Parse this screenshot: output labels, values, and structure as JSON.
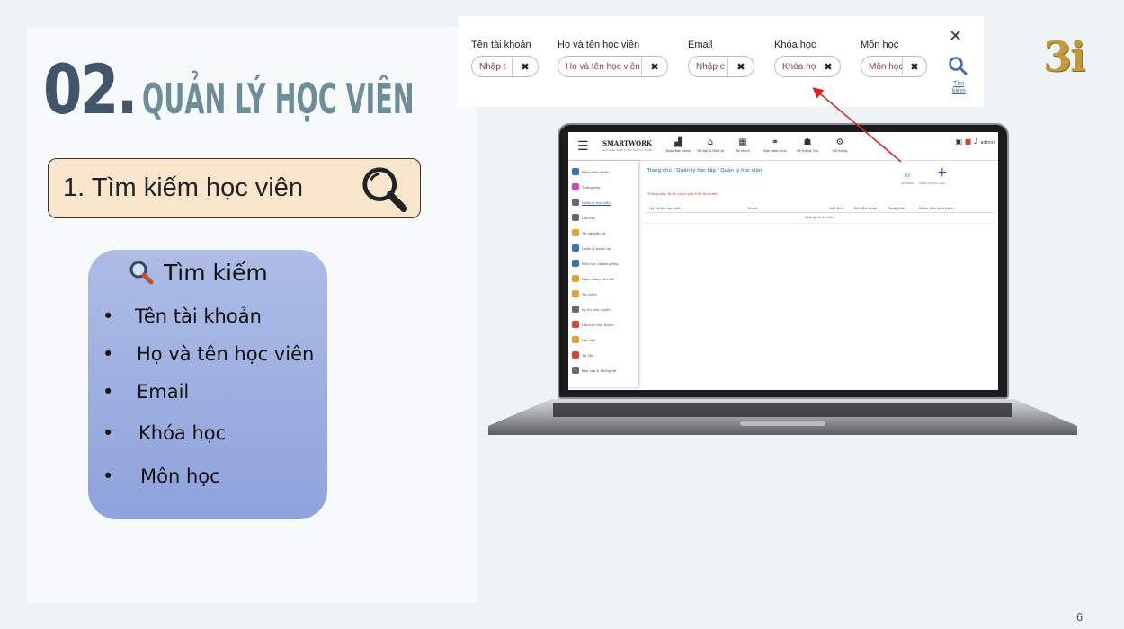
{
  "slide": {
    "section_number": "02.",
    "section_title": "QUẢN LÝ HỌC VIÊN",
    "subtitle": "1. Tìm kiếm học viên",
    "page_number": "6",
    "brand": "3i"
  },
  "feature_card": {
    "heading": "Tìm kiếm",
    "items": [
      "Tên tài khoản",
      "Họ và tên học viên",
      "Email",
      "Khóa học",
      "Môn học"
    ]
  },
  "search_strip": {
    "fields": [
      {
        "label": "Tên tài khoản",
        "placeholder": "Nhập t"
      },
      {
        "label": "Họ và tên học viên",
        "placeholder": "Họ và tên học viên"
      },
      {
        "label": "Email",
        "placeholder": "Nhập e"
      },
      {
        "label": "Khóa học",
        "placeholder": "Khóa học"
      },
      {
        "label": "Môn học",
        "placeholder": "Môn học"
      }
    ],
    "clear_glyph": "✖",
    "close_glyph": "✕",
    "search_label": "Tìm kiếm"
  },
  "app": {
    "brand": "SMARTWORK",
    "brand_sub": "Giải pháp quản lý đào tạo trực tuyến",
    "top_nav": [
      {
        "label": "Khóa bán hàng",
        "icon": "chart-icon"
      },
      {
        "label": "Tài sản & thiết bị",
        "icon": "bank-icon"
      },
      {
        "label": "Tài chính",
        "icon": "building-icon"
      },
      {
        "label": "Đơn giáo trình",
        "icon": "share-icon"
      },
      {
        "label": "Hệ thống Thư",
        "icon": "people-icon"
      },
      {
        "label": "Hệ thống",
        "icon": "gear-icon"
      }
    ],
    "top_right": "admin",
    "sidebar": [
      {
        "label": "Bảng điều khiển",
        "color": "#3a6fb0"
      },
      {
        "label": "Thông báo",
        "color": "#d64aa8"
      },
      {
        "label": "Quản lý học viên",
        "color": "#6a6a6a",
        "active": true
      },
      {
        "label": "Lớp học",
        "color": "#6a6a6a"
      },
      {
        "label": "Tài nguyên số",
        "color": "#e0a33a"
      },
      {
        "label": "Quản lý khóa học",
        "color": "#3a6fb0"
      },
      {
        "label": "Môn học và bài giảng",
        "color": "#3a6fb0"
      },
      {
        "label": "Ngân hàng câu hỏi",
        "color": "#e0a33a"
      },
      {
        "label": "Tài chính",
        "color": "#e0a33a"
      },
      {
        "label": "Kỳ thi trực tuyến",
        "color": "#6a6a6a"
      },
      {
        "label": "Lớp học trực tuyến",
        "color": "#d6453a"
      },
      {
        "label": "Học liệu",
        "color": "#e0a33a"
      },
      {
        "label": "Tài liệu",
        "color": "#d6453a"
      },
      {
        "label": "Báo cáo & Thống kê",
        "color": "#6a6a6a"
      }
    ],
    "breadcrumb": "Trang chủ / Quản lý học tập / Quản lý học viên",
    "notice": "Thông báo: Nhấn chọn vào ô để tìm kiếm",
    "actions": {
      "search": "Tìm kiếm",
      "add": "Thêm mới học viên"
    },
    "table_headers": [
      "Họ và tên học viên",
      "Email",
      "Giới tính",
      "Số điện thoại",
      "Trạng thái",
      "Nhân viên phụ trách"
    ],
    "empty_text": "Không có dữ liệu"
  },
  "colors": {
    "section_number": "#44546a",
    "section_title": "#6e8d99",
    "pill_bg": "#f9e6cc",
    "card_bg": "#9cb0e0",
    "arrow": "#e02020",
    "brand": "#c39a3a"
  }
}
